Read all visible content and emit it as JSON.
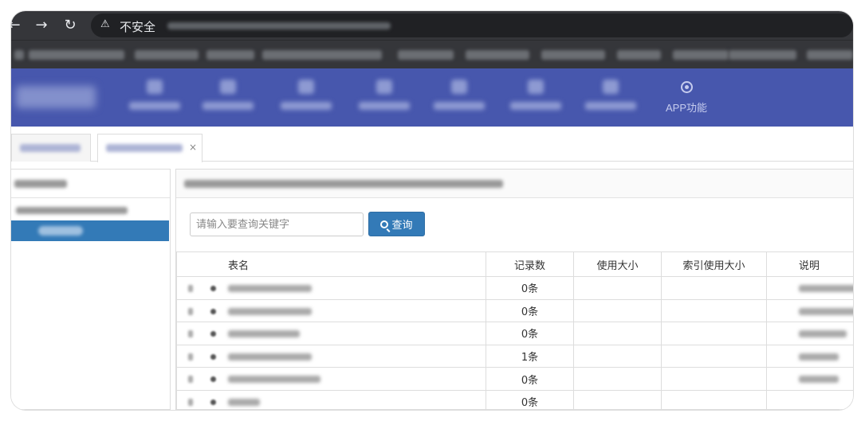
{
  "browser": {
    "security_label": "不安全",
    "warning_icon": "⚠"
  },
  "header": {
    "nav_items": [
      {
        "icon": "blurred-icon"
      },
      {
        "icon": "blurred-icon"
      },
      {
        "icon": "blurred-icon"
      },
      {
        "icon": "blurred-icon"
      },
      {
        "icon": "blurred-icon"
      },
      {
        "icon": "blurred-icon"
      },
      {
        "icon": "blurred-icon"
      }
    ],
    "app_function_label": "APP功能",
    "colors": {
      "header_bg": "#4757ad",
      "primary": "#337ab7"
    }
  },
  "search": {
    "placeholder": "请输入要查询关键字",
    "button_label": "查询"
  },
  "table": {
    "columns": [
      "表名",
      "记录数",
      "使用大小",
      "索引使用大小",
      "说明"
    ],
    "rows": [
      {
        "records": "0条",
        "size": "",
        "index_size": ""
      },
      {
        "records": "0条",
        "size": "",
        "index_size": ""
      },
      {
        "records": "0条",
        "size": "",
        "index_size": ""
      },
      {
        "records": "1条",
        "size": "",
        "index_size": ""
      },
      {
        "records": "0条",
        "size": "",
        "index_size": ""
      },
      {
        "records": "0条",
        "size": "",
        "index_size": ""
      }
    ]
  }
}
